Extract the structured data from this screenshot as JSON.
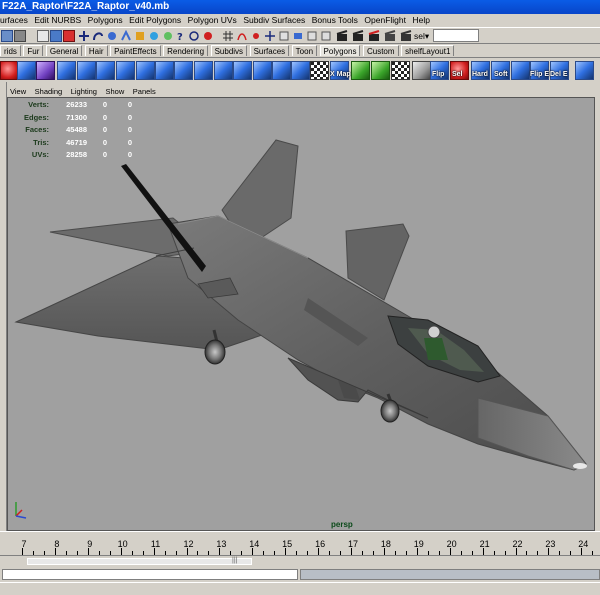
{
  "window": {
    "title": "F22A_Raptor\\F22A_Raptor_v40.mb"
  },
  "menubar": [
    "urfaces",
    "Edit NURBS",
    "Polygons",
    "Edit Polygons",
    "Polygon UVs",
    "Subdiv Surfaces",
    "Bonus Tools",
    "OpenFlight",
    "Help"
  ],
  "statusline": {
    "sel_label": "sel▾",
    "sel_value": ""
  },
  "shelf": {
    "tabs": [
      "rids",
      "Fur",
      "General",
      "Hair",
      "PaintEffects",
      "Rendering",
      "Subdivs",
      "Surfaces",
      "Toon",
      "Polygons",
      "Custom",
      "shelfLayout1"
    ],
    "active_tab": "Polygons",
    "icon_labels": [
      "X Map",
      "Flip",
      "Sel",
      "Hard",
      "Soft",
      "Flip E",
      "Del E"
    ]
  },
  "panel_menu": [
    "View",
    "Shading",
    "Lighting",
    "Show",
    "Panels"
  ],
  "hud": [
    {
      "label": "Verts:",
      "v1": "26233",
      "v2": "0",
      "v3": "0"
    },
    {
      "label": "Edges:",
      "v1": "71300",
      "v2": "0",
      "v3": "0"
    },
    {
      "label": "Faces:",
      "v1": "45488",
      "v2": "0",
      "v3": "0"
    },
    {
      "label": "Tris:",
      "v1": "46719",
      "v2": "0",
      "v3": "0"
    },
    {
      "label": "UVs:",
      "v1": "28258",
      "v2": "0",
      "v3": "0"
    }
  ],
  "viewport": {
    "camera": "persp",
    "background": "#a0a0a0"
  },
  "timeslider": {
    "labels": [
      "7",
      "8",
      "9",
      "10",
      "11",
      "12",
      "13",
      "14",
      "15",
      "16",
      "17",
      "18",
      "19",
      "20",
      "21",
      "22",
      "23",
      "24"
    ]
  },
  "colors": {
    "title_bar": "#0a5ce6",
    "ui_gray": "#d4d0c8",
    "viewport": "#a0a0a0",
    "hud_label": "#1c3a1c"
  }
}
